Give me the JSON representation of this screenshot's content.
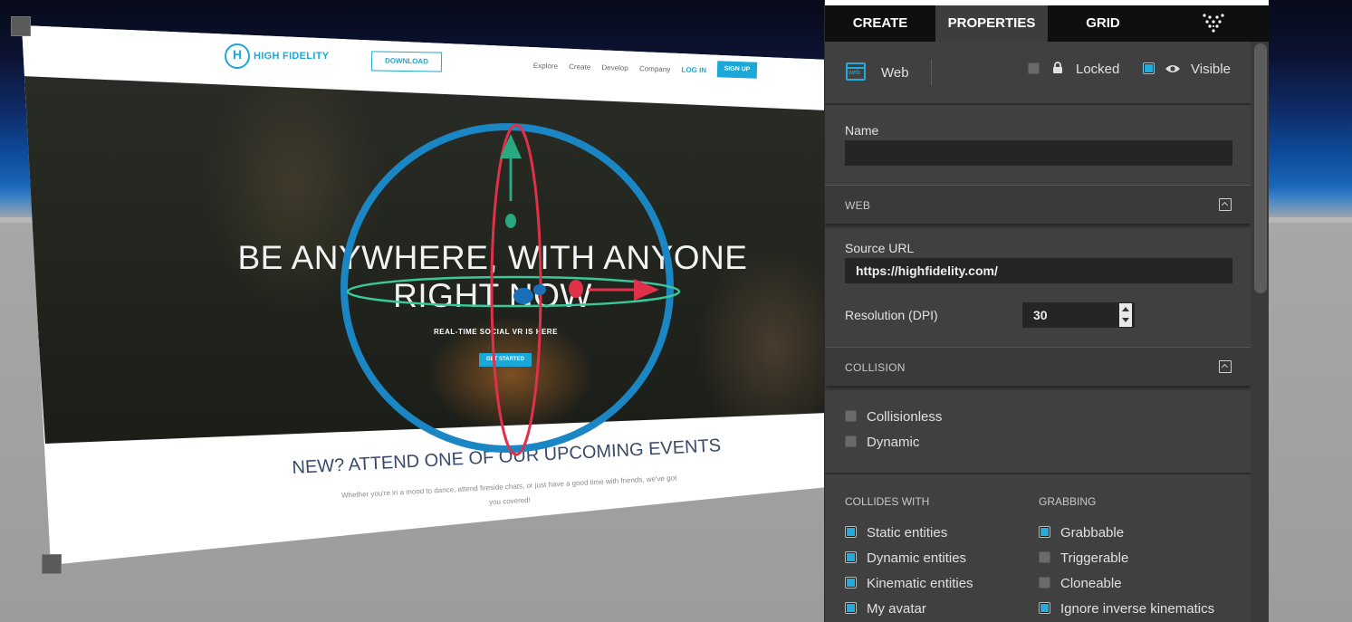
{
  "website": {
    "logo_text": "HIGH FIDELITY",
    "logo_glyph": "H",
    "download_label": "DOWNLOAD",
    "nav": [
      "Explore",
      "Create",
      "Develop",
      "Company"
    ],
    "login_label": "LOG IN",
    "signup_label": "SIGN UP",
    "hero_line1": "BE ANYWHERE, WITH ANYONE",
    "hero_line2": "RIGHT NOW",
    "hero_sub": "REAL-TIME SOCIAL VR IS HERE",
    "hero_button": "GET STARTED",
    "events_title": "NEW? ATTEND ONE OF OUR UPCOMING EVENTS",
    "events_desc": "Whether you're in a mood to dance, attend fireside chats, or just have a good time with friends, we've got you covered!"
  },
  "panel": {
    "tabs": [
      "CREATE",
      "PROPERTIES",
      "GRID"
    ],
    "active_tab": "PROPERTIES",
    "tab_logo_icon": "high-fidelity-logo-icon",
    "entity": {
      "type_icon": "web-icon",
      "type_icon_label": "web",
      "type_label": "Web",
      "locked_label": "Locked",
      "locked": false,
      "visible_label": "Visible",
      "visible": true
    },
    "name_label": "Name",
    "name_value": "",
    "web_section": {
      "title": "WEB",
      "source_url_label": "Source URL",
      "source_url_value": "https://highfidelity.com/",
      "dpi_label": "Resolution (DPI)",
      "dpi_value": "30"
    },
    "collision_section": {
      "title": "COLLISION",
      "collisionless_label": "Collisionless",
      "collisionless": false,
      "dynamic_label": "Dynamic",
      "dynamic": false,
      "collides_with_title": "COLLIDES WITH",
      "collides_with": [
        {
          "label": "Static entities",
          "checked": true
        },
        {
          "label": "Dynamic entities",
          "checked": true
        },
        {
          "label": "Kinematic entities",
          "checked": true
        },
        {
          "label": "My avatar",
          "checked": true
        }
      ],
      "grabbing_title": "GRABBING",
      "grabbing": [
        {
          "label": "Grabbable",
          "checked": true
        },
        {
          "label": "Triggerable",
          "checked": false
        },
        {
          "label": "Cloneable",
          "checked": false
        },
        {
          "label": "Ignore inverse kinematics",
          "checked": true
        }
      ]
    }
  },
  "colors": {
    "accent": "#25aadc",
    "gizmo_ring_blue": "#1a86c4",
    "gizmo_ring_red": "#e0304a",
    "gizmo_ring_green": "#3ac79a"
  }
}
